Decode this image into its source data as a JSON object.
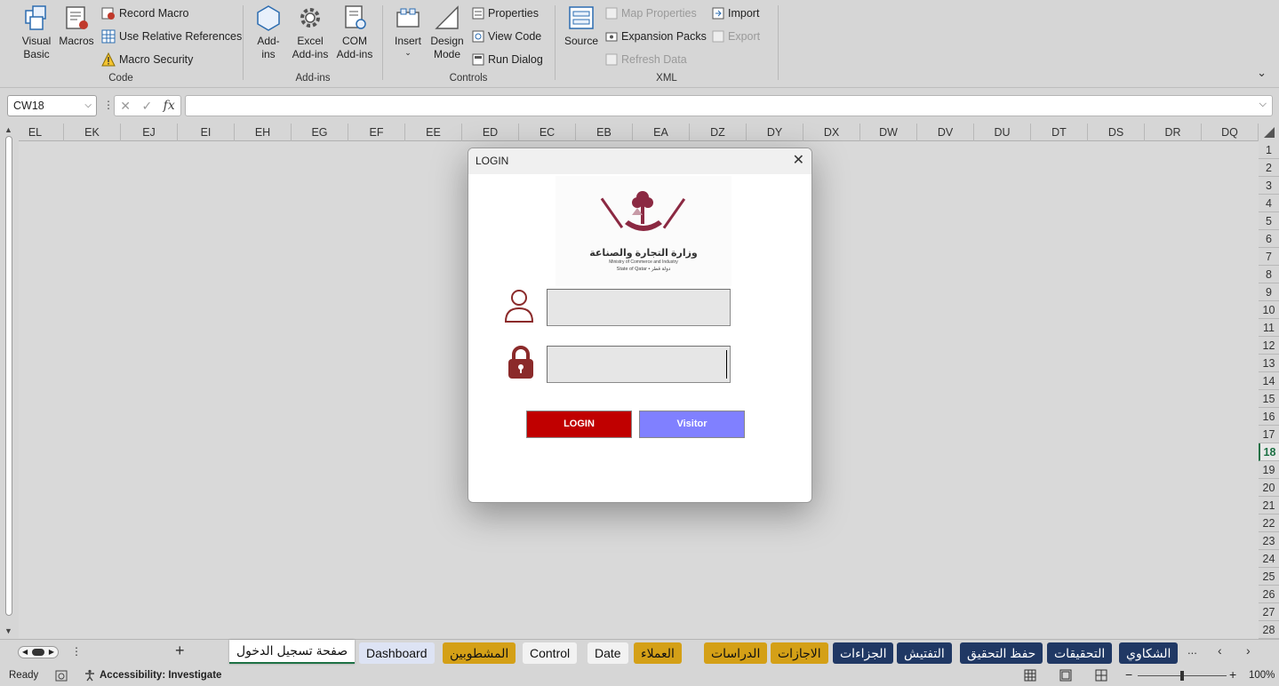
{
  "ribbon": {
    "code": {
      "label": "Code",
      "visual_basic": "Visual Basic",
      "macros": "Macros",
      "record_macro": "Record Macro",
      "use_relative_references": "Use Relative References",
      "macro_security": "Macro Security"
    },
    "addins": {
      "label": "Add-ins",
      "addins": "Add-ins",
      "excel_addins": "Excel Add-ins",
      "com_addins": "COM Add-ins"
    },
    "controls": {
      "label": "Controls",
      "insert": "Insert",
      "design_mode": "Design Mode",
      "properties": "Properties",
      "view_code": "View Code",
      "run_dialog": "Run Dialog"
    },
    "xml": {
      "label": "XML",
      "source": "Source",
      "map_properties": "Map Properties",
      "expansion_packs": "Expansion Packs",
      "refresh_data": "Refresh Data",
      "import": "Import",
      "export": "Export"
    }
  },
  "formula_bar": {
    "name_box": "CW18",
    "fx": "fx",
    "formula": ""
  },
  "columns": [
    "EL",
    "EK",
    "EJ",
    "EI",
    "EH",
    "EG",
    "EF",
    "EE",
    "ED",
    "EC",
    "EB",
    "EA",
    "DZ",
    "DY",
    "DX",
    "DW",
    "DV",
    "DU",
    "DT",
    "DS",
    "DR",
    "DQ"
  ],
  "rows": [
    "1",
    "2",
    "3",
    "4",
    "5",
    "6",
    "7",
    "8",
    "9",
    "10",
    "11",
    "12",
    "13",
    "14",
    "15",
    "16",
    "17",
    "18",
    "19",
    "20",
    "21",
    "22",
    "23",
    "24",
    "25",
    "26",
    "27",
    "28"
  ],
  "selected_row": "18",
  "dialog": {
    "title": "LOGIN",
    "logo_arabic": "وزارة التجارة والصناعة",
    "logo_english": "Ministry of Commerce and Industry",
    "logo_state": "State of Qatar • دولة قطر",
    "username_value": "",
    "password_value": "",
    "login_button": "LOGIN",
    "visitor_button": "Visitor",
    "login_color": "#c00000",
    "visitor_color": "#8080ff",
    "icon_color": "#8b2a2a"
  },
  "sheet_tabs": [
    {
      "label": "صفحة تسجيل الدخول",
      "bg": "#ffffff",
      "color": "#111111"
    },
    {
      "label": "Dashboard",
      "bg": "#dde3f4",
      "color": "#111111"
    },
    {
      "label": "المشطوبين",
      "bg": "#d4a017",
      "color": "#111111"
    },
    {
      "label": "Control",
      "bg": "#f2f2f2",
      "color": "#111111"
    },
    {
      "label": "Date",
      "bg": "#f2f2f2",
      "color": "#111111"
    },
    {
      "label": "العملاء",
      "bg": "#d4a017",
      "color": "#111111"
    },
    {
      "label": "الدراسات",
      "bg": "#d4a017",
      "color": "#111111"
    },
    {
      "label": "الاجازات",
      "bg": "#d4a017",
      "color": "#111111"
    },
    {
      "label": "الجزاءات",
      "bg": "#203864",
      "color": "#ffffff"
    },
    {
      "label": "التفتيش",
      "bg": "#203864",
      "color": "#ffffff"
    },
    {
      "label": "حفظ التحقيق",
      "bg": "#203864",
      "color": "#ffffff"
    },
    {
      "label": "التحقيقات",
      "bg": "#203864",
      "color": "#ffffff"
    },
    {
      "label": "الشكاوي",
      "bg": "#203864",
      "color": "#ffffff"
    }
  ],
  "tab_more": "...",
  "add_sheet": "+",
  "status": {
    "ready": "Ready",
    "accessibility": "Accessibility: Investigate",
    "zoom": "100%",
    "zoom_level": 1.0
  }
}
